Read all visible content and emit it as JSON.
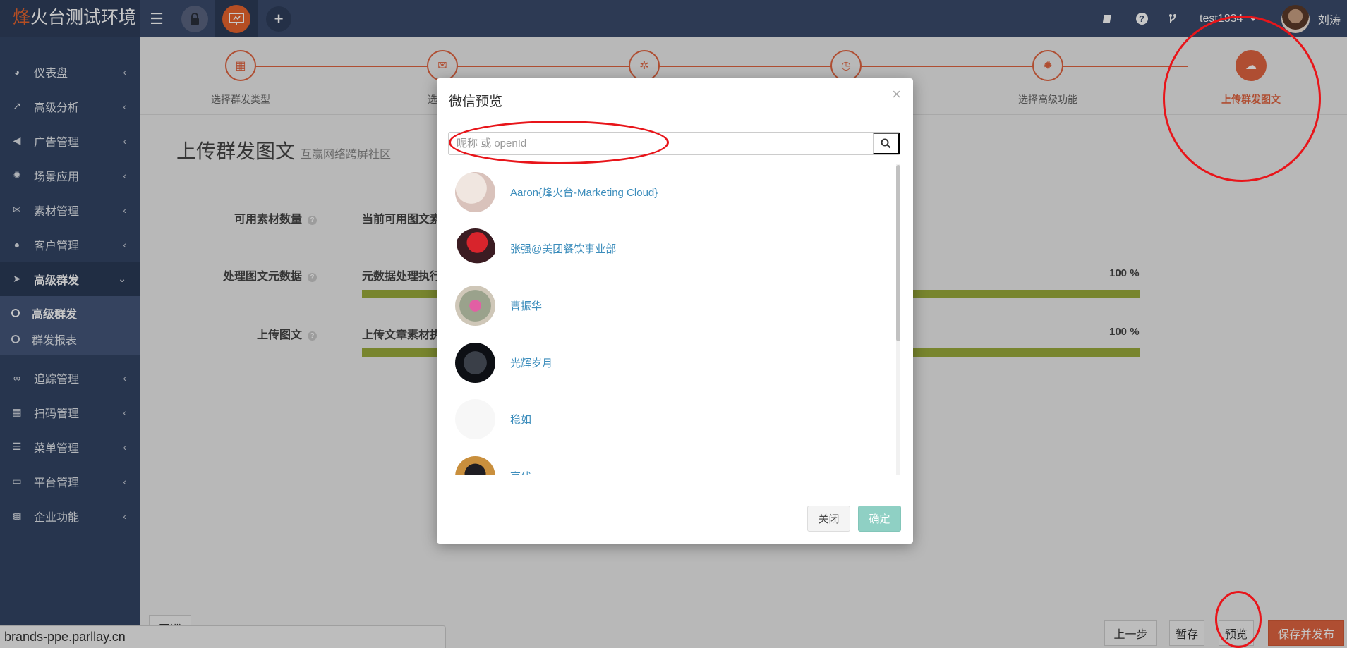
{
  "brand": {
    "accent": "烽",
    "rest": "火台测试环境"
  },
  "topbar": {
    "user_account": "test1834",
    "user_name": "刘涛"
  },
  "sidebar": {
    "items": [
      {
        "label": "仪表盘",
        "icon": "dashboard-icon"
      },
      {
        "label": "高级分析",
        "icon": "line-chart-icon"
      },
      {
        "label": "广告管理",
        "icon": "bullhorn-icon"
      },
      {
        "label": "场景应用",
        "icon": "gear-icon"
      },
      {
        "label": "素材管理",
        "icon": "envelope-icon"
      },
      {
        "label": "客户管理",
        "icon": "user-icon"
      },
      {
        "label": "高级群发",
        "icon": "paper-plane-icon"
      },
      {
        "label": "追踪管理",
        "icon": "link-icon"
      },
      {
        "label": "扫码管理",
        "icon": "qrcode-icon"
      },
      {
        "label": "菜单管理",
        "icon": "list-icon"
      },
      {
        "label": "平台管理",
        "icon": "desktop-icon"
      },
      {
        "label": "企业功能",
        "icon": "grid-icon"
      }
    ],
    "subitems": [
      {
        "label": "高级群发"
      },
      {
        "label": "群发报表"
      }
    ]
  },
  "steps": [
    {
      "label": "选择群发类型"
    },
    {
      "label": "选择群"
    },
    {
      "label": ""
    },
    {
      "label": ""
    },
    {
      "label": "选择高级功能"
    },
    {
      "label": "上传群发图文"
    }
  ],
  "page": {
    "title": "上传群发图文",
    "subtitle": "互赢网络跨屏社区"
  },
  "form": {
    "row1_label": "可用素材数量",
    "row1_value": "当前可用图文素",
    "row2_label": "处理图文元数据",
    "row2_value": "元数据处理执行",
    "row2_pct": "100 %",
    "row2_progress": 1.0,
    "row3_label": "上传图文",
    "row3_value": "上传文章素材执",
    "row3_pct": "100 %",
    "row3_progress": 1.0
  },
  "footer": {
    "left_label": "图巡",
    "prev": "上一步",
    "save_draft": "暂存",
    "preview": "预览",
    "save_publish": "保存并发布"
  },
  "url_status": "brands-ppe.parllay.cn",
  "modal": {
    "title": "微信预览",
    "close_glyph": "×",
    "search_placeholder": "昵称 或 openId",
    "users": [
      {
        "name": "Aaron{烽火台-Marketing Cloud}"
      },
      {
        "name": "张强@美团餐饮事业部"
      },
      {
        "name": "曹振华"
      },
      {
        "name": "光辉岁月"
      },
      {
        "name": "稳如"
      },
      {
        "name": "高伏"
      }
    ],
    "close_label": "关闭",
    "confirm_label": "确定"
  },
  "colors": {
    "accent": "#e06440",
    "sidebar": "#324565",
    "topbar": "#3a4b6c",
    "progress": "#9aab3b",
    "link": "#3c8dbc",
    "annotation": "#e8151a"
  }
}
